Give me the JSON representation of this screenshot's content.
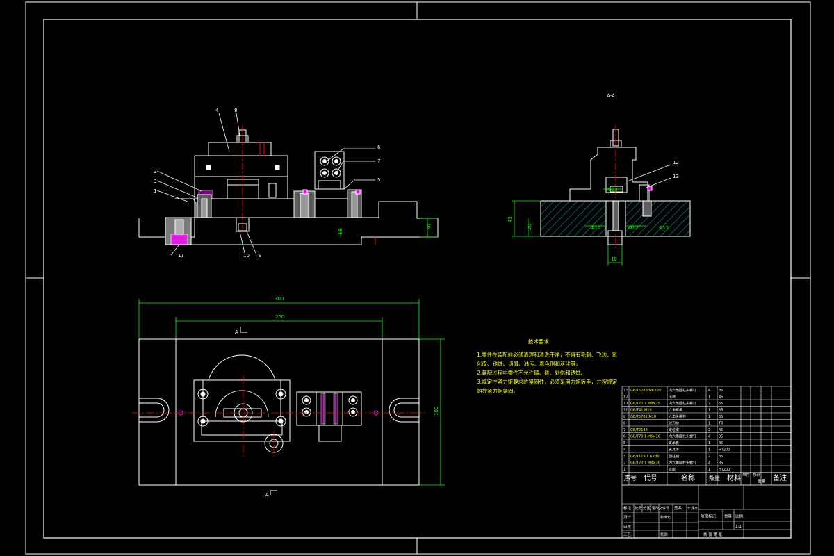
{
  "colors": {
    "background": "#000000",
    "outline": "#ffffff",
    "dimension": "#00ff00",
    "centerline": "#ff0000",
    "hatch": "#00a0a0",
    "hole": "#ff00ff",
    "notes": "#ffff00",
    "frame": "#ffffff"
  },
  "section_title": "A-A",
  "section_marks": [
    "A",
    "A"
  ],
  "dimensions": {
    "overall_length": "300",
    "slot_spacing": "250",
    "plate_width": "180",
    "front_height": "30",
    "front_small": "18",
    "section_height_left": "45",
    "section_plate": "20",
    "section_bottom": "10",
    "section_dia_1": "Φ12",
    "section_dia_2": "Φ12",
    "section_dia_3": "Φ23",
    "section_dia_4": "Φ12"
  },
  "balloons": {
    "front": [
      "4",
      "8",
      "2",
      "3",
      "1",
      "11",
      "6",
      "7",
      "5",
      "10",
      "9"
    ],
    "section": [
      "12",
      "13"
    ]
  },
  "tech_notes": {
    "title": "技术要求",
    "lines": [
      "1.零件在装配前必须清理和清洗干净，不得有毛刺、飞边、氧",
      "化皮、锈蚀、切屑、油污、着色剂和灰尘等。",
      "2.装配过程中零件不允许磕、碰、划伤和锈蚀。",
      "3.规定拧紧力矩要求的紧固件，必须采用力矩扳手，并按规定",
      "的拧紧力矩紧固。"
    ]
  },
  "parts_list": {
    "rows": [
      [
        "13",
        "GB/T5783 M6×20",
        "内六角圆柱头螺钉",
        "4",
        "35",
        ""
      ],
      [
        "12",
        "",
        "压块",
        "1",
        "45",
        ""
      ],
      [
        "11",
        "GB/T70.1 M8×25",
        "内六角圆柱头螺钉",
        "2",
        "35",
        ""
      ],
      [
        "10",
        "GB/T41 M10",
        "六角螺母",
        "1",
        "35",
        ""
      ],
      [
        "9",
        "GB/T5782 M10",
        "六角头螺栓",
        "1",
        "35",
        ""
      ],
      [
        "8",
        "",
        "对刀块",
        "1",
        "T8",
        ""
      ],
      [
        "7",
        "GB/T2148",
        "定位键",
        "2",
        "45",
        ""
      ],
      [
        "6",
        "GB/T70.1 M6×16",
        "内六角圆柱头螺钉",
        "4",
        "35",
        ""
      ],
      [
        "5",
        "",
        "支承板",
        "1",
        "45",
        ""
      ],
      [
        "4",
        "",
        "夹具体",
        "1",
        "HT200",
        ""
      ],
      [
        "3",
        "GB/T119.1 6×30",
        "圆柱销",
        "2",
        "35",
        ""
      ],
      [
        "2",
        "GB/T70.1 M8×30",
        "内六角圆柱头螺钉",
        "4",
        "35",
        ""
      ],
      [
        "1",
        "",
        "底座",
        "1",
        "HT200",
        ""
      ]
    ],
    "header": {
      "index": "序号",
      "code": "代号",
      "name": "名称",
      "qty": "数量",
      "material": "材料",
      "single": "单件",
      "total": "总计",
      "weight": "重量",
      "remark": "备注"
    }
  },
  "title_block": {
    "labels": {
      "marks": "标记",
      "count": "处数",
      "zone": "分区",
      "change_no": "更改文件号",
      "sign": "签名",
      "date": "年月日",
      "design": "设计",
      "standard": "标准化",
      "review": "审核",
      "process": "工艺",
      "approve": "批准",
      "stage": "阶段标记",
      "weight": "重量",
      "scale": "比例",
      "sheets": "共 张 第 张"
    },
    "scale_value": "1:1"
  }
}
